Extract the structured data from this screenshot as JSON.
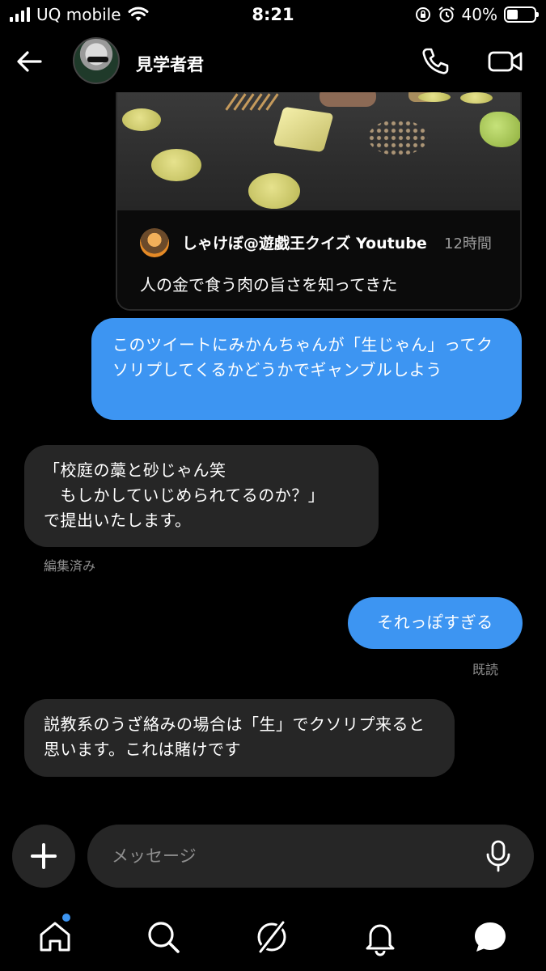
{
  "status_bar": {
    "carrier": "UQ mobile",
    "time": "8:21",
    "battery": "40%",
    "battery_level": 0.4,
    "icons": [
      "signal-icon",
      "wifi-icon",
      "orientation-lock-icon",
      "alarm-icon",
      "battery-icon"
    ]
  },
  "header": {
    "contact_name": "見学者君",
    "icons": [
      "back-arrow-icon",
      "phone-icon",
      "video-camera-icon"
    ]
  },
  "shared_post": {
    "author": "しゃけぼ@遊戯王クイズ Youtube",
    "time": "12時間",
    "text": "人の金で食う肉の旨さを知ってきた"
  },
  "messages": [
    {
      "direction": "sent",
      "text": "このツイートにみかんちゃんが「生じゃん」ってクソリプしてくるかどうかでギャンブルしよう"
    },
    {
      "direction": "received",
      "text": "「校庭の藁と砂じゃん笑\n　もしかしていじめられてるのか？」\nで提出いたします。",
      "meta": "編集済み"
    },
    {
      "direction": "sent",
      "text": "それっぽすぎる",
      "meta": "既読"
    },
    {
      "direction": "received",
      "text": "説教系のうざ絡みの場合は「生」でクソリプ来ると思います。これは賭けです"
    }
  ],
  "composer": {
    "placeholder": "メッセージ",
    "icons": [
      "plus-icon",
      "microphone-icon"
    ]
  },
  "bottom_nav": {
    "items": [
      "home-icon",
      "search-icon",
      "explore-icon",
      "bell-icon",
      "chat-icon"
    ],
    "home_has_badge": true
  },
  "colors": {
    "background": "#000000",
    "sent_bubble": "#3d95f2",
    "received_bubble": "#262626",
    "meta_text": "#8e8e8e"
  }
}
